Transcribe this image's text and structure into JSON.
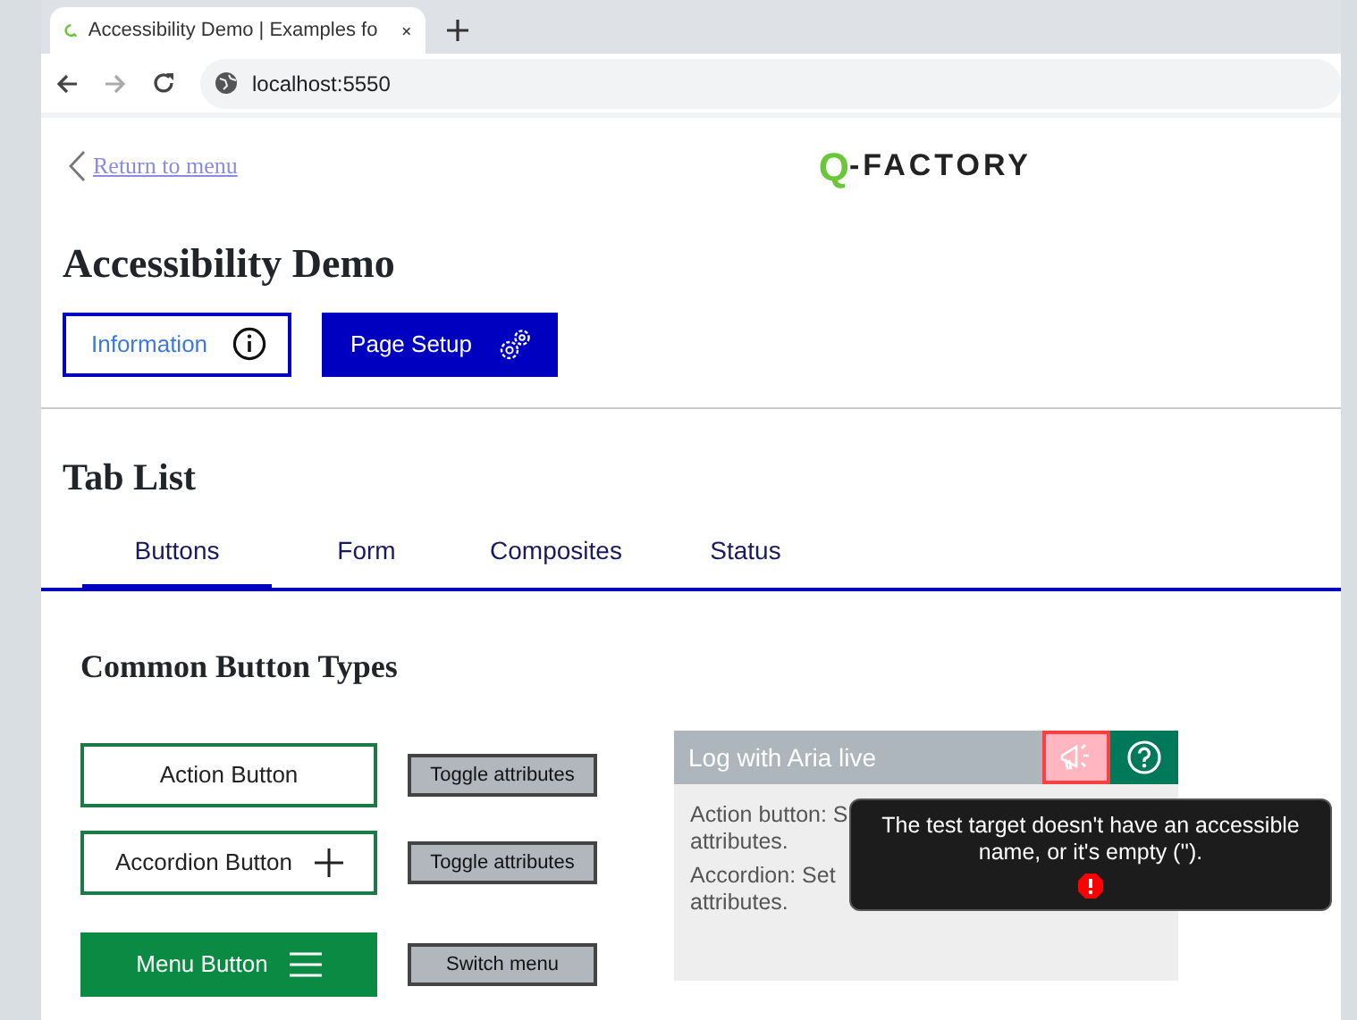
{
  "browser": {
    "tab_title": "Accessibility Demo | Examples fo",
    "address": "localhost:5550"
  },
  "header": {
    "back_link": "Return to menu",
    "logo": {
      "mark": "Q",
      "text": "-FACTORY"
    }
  },
  "title": "Accessibility Demo",
  "top_buttons": [
    {
      "label": "Information",
      "kind": "info"
    },
    {
      "label": "Page Setup",
      "kind": "setup"
    }
  ],
  "tab_list": {
    "heading": "Tab List",
    "tabs": [
      {
        "label": "Buttons",
        "selected": true
      },
      {
        "label": "Form",
        "selected": false
      },
      {
        "label": "Composites",
        "selected": false
      },
      {
        "label": "Status",
        "selected": false
      }
    ]
  },
  "section_heading": "Common Button Types",
  "button_rows": [
    {
      "label": "Action Button",
      "kind": "action",
      "side_button": "Toggle attributes"
    },
    {
      "label": "Accordion Button",
      "kind": "accordion",
      "side_button": "Toggle attributes"
    },
    {
      "label": "Menu Button",
      "kind": "menu",
      "side_button": "Switch menu"
    }
  ],
  "log_panel": {
    "title": "Log with Aria live",
    "entries": [
      [
        "Action button: S",
        "attributes."
      ],
      [
        "Accordion: Set",
        "attributes."
      ]
    ]
  },
  "tooltip": {
    "text": "The test target doesn't have an accessible name, or it's empty ('')."
  }
}
